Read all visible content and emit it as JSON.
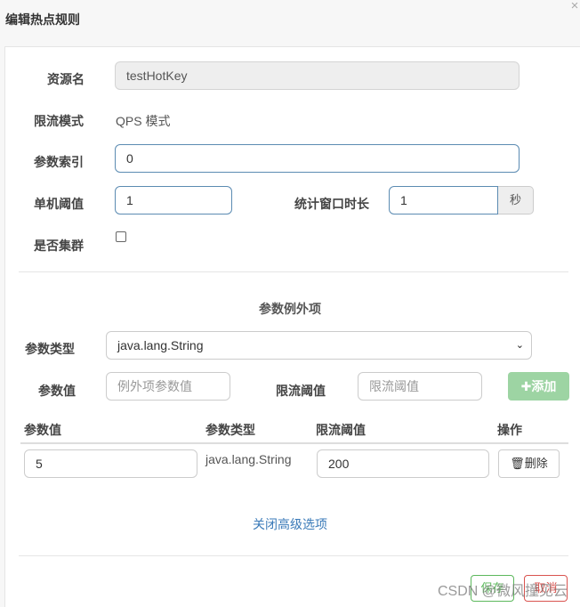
{
  "header": {
    "title": "编辑热点规则",
    "close": "×"
  },
  "form": {
    "resource_label": "资源名",
    "resource_value": "testHotKey",
    "mode_label": "限流模式",
    "mode_value": "QPS 模式",
    "param_index_label": "参数索引",
    "param_index_value": "0",
    "threshold_label": "单机阈值",
    "threshold_value": "1",
    "window_label": "统计窗口时长",
    "window_value": "1",
    "window_unit": "秒",
    "cluster_label": "是否集群",
    "cluster_checked": false
  },
  "exceptions": {
    "title": "参数例外项",
    "type_label": "参数类型",
    "type_value": "java.lang.String",
    "value_label": "参数值",
    "value_placeholder": "例外项参数值",
    "limit_label": "限流阈值",
    "limit_placeholder": "限流阈值",
    "add_button": "添加",
    "add_icon": "plus-icon",
    "table": {
      "columns": [
        "参数值",
        "参数类型",
        "限流阈值",
        "操作"
      ],
      "rows": [
        {
          "value": "5",
          "type": "java.lang.String",
          "limit": "200",
          "action": "删除",
          "action_icon": "trash-icon"
        }
      ]
    }
  },
  "advanced_link": "关闭高级选项",
  "footer": {
    "save": "保存",
    "cancel": "取消"
  },
  "watermark": "CSDN @微风撞见云",
  "colors": {
    "accent_link": "#3a7ab8",
    "add_button": "#9dd4a3",
    "save": "#5cb85c",
    "cancel": "#d9534f"
  }
}
